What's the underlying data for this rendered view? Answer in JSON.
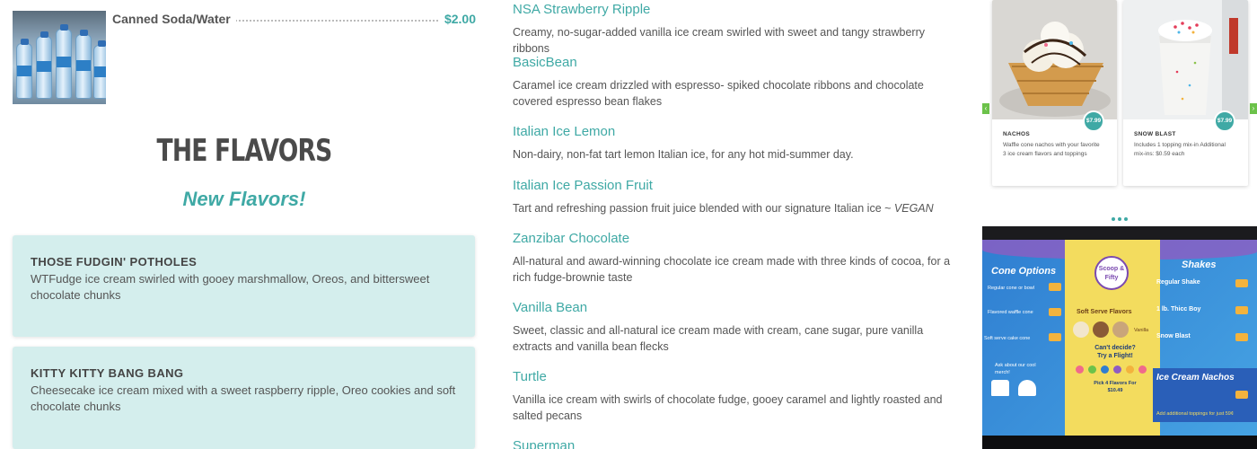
{
  "menu_item": {
    "name": "Canned Soda/Water",
    "price": "$2.00",
    "image_icon": "water-bottles-photo"
  },
  "flavors_section": {
    "heading": "THE FLAVORS",
    "subheading": "New Flavors!"
  },
  "new_flavor_cards": [
    {
      "title": "THOSE FUDGIN' POTHOLES",
      "description": "WTFudge ice cream swirled with gooey marshmallow, Oreos, and bittersweet chocolate chunks"
    },
    {
      "title": "KITTY KITTY BANG BANG",
      "description": "Cheesecake ice cream mixed with a sweet raspberry ripple, Oreo cookies and soft chocolate chunks"
    }
  ],
  "flavor_list": [
    {
      "name": "NSA Strawberry Ripple",
      "description": "Creamy, no-sugar-added vanilla ice cream swirled with sweet and tangy strawberry ribbons"
    },
    {
      "name": "BasicBean",
      "description": "Caramel ice cream drizzled with espresso- spiked chocolate ribbons and chocolate covered espresso bean flakes"
    },
    {
      "name": "Italian Ice Lemon",
      "description": "Non-dairy, non-fat tart lemon Italian ice, for any hot mid-summer day."
    },
    {
      "name": "Italian Ice Passion Fruit",
      "description": "Tart and refreshing passion fruit juice blended with our signature Italian ice ~ ",
      "emphasis": "VEGAN"
    },
    {
      "name": "Zanzibar Chocolate",
      "description": "All-natural and award-winning chocolate ice cream made with three kinds of cocoa, for a rich fudge-brownie taste"
    },
    {
      "name": "Vanilla Bean",
      "description": "Sweet, classic and all-natural ice cream made with cream, cane sugar, pure vanilla extracts and vanilla bean flecks"
    },
    {
      "name": "Turtle",
      "description": "Vanilla ice cream with swirls of chocolate fudge, gooey caramel and lightly roasted and salted pecans"
    },
    {
      "name": "Superman",
      "description": ""
    }
  ],
  "promo_cards": [
    {
      "title": "NACHOS",
      "price": "$7.99",
      "description": "Waffle cone nachos with your favorite 3 ice cream flavors and toppings"
    },
    {
      "title": "SNOW BLAST",
      "price": "$7.99",
      "description": "Includes 1 topping mix-in Additional mix-ins: $0.59 each"
    }
  ],
  "carousel": {
    "prev_icon": "chevron-left-icon",
    "next_icon": "chevron-right-icon",
    "prev_glyph": "‹",
    "next_glyph": "›"
  },
  "menu_board": {
    "cone_options_title": "Cone Options",
    "cone_items": [
      "Regular cone or bowl",
      "Flavored waffle cone",
      "Soft serve cake cone"
    ],
    "merch_text": "Ask about our cool merch!",
    "center_title": "Soft Serve Flavors",
    "logo_text": "Scoop & Fifty",
    "flavor_badge": "Vanilla",
    "flight_text": "Can't decide? Try a Flight!",
    "flight_detail": "Pick 4 Flavors For $10.49",
    "shakes_title": "Shakes",
    "shakes_items": [
      "Regular Shake",
      "1 lb. Thicc Boy",
      "Snow Blast"
    ],
    "nachos_title": "Ice Cream Nachos",
    "nachos_footer": "Add additional toppings for just 59¢"
  },
  "colors": {
    "accent_teal": "#3fa9a5",
    "card_bg": "#d4eeed",
    "heading_text": "#4a4a4a",
    "body_text": "#555555"
  }
}
